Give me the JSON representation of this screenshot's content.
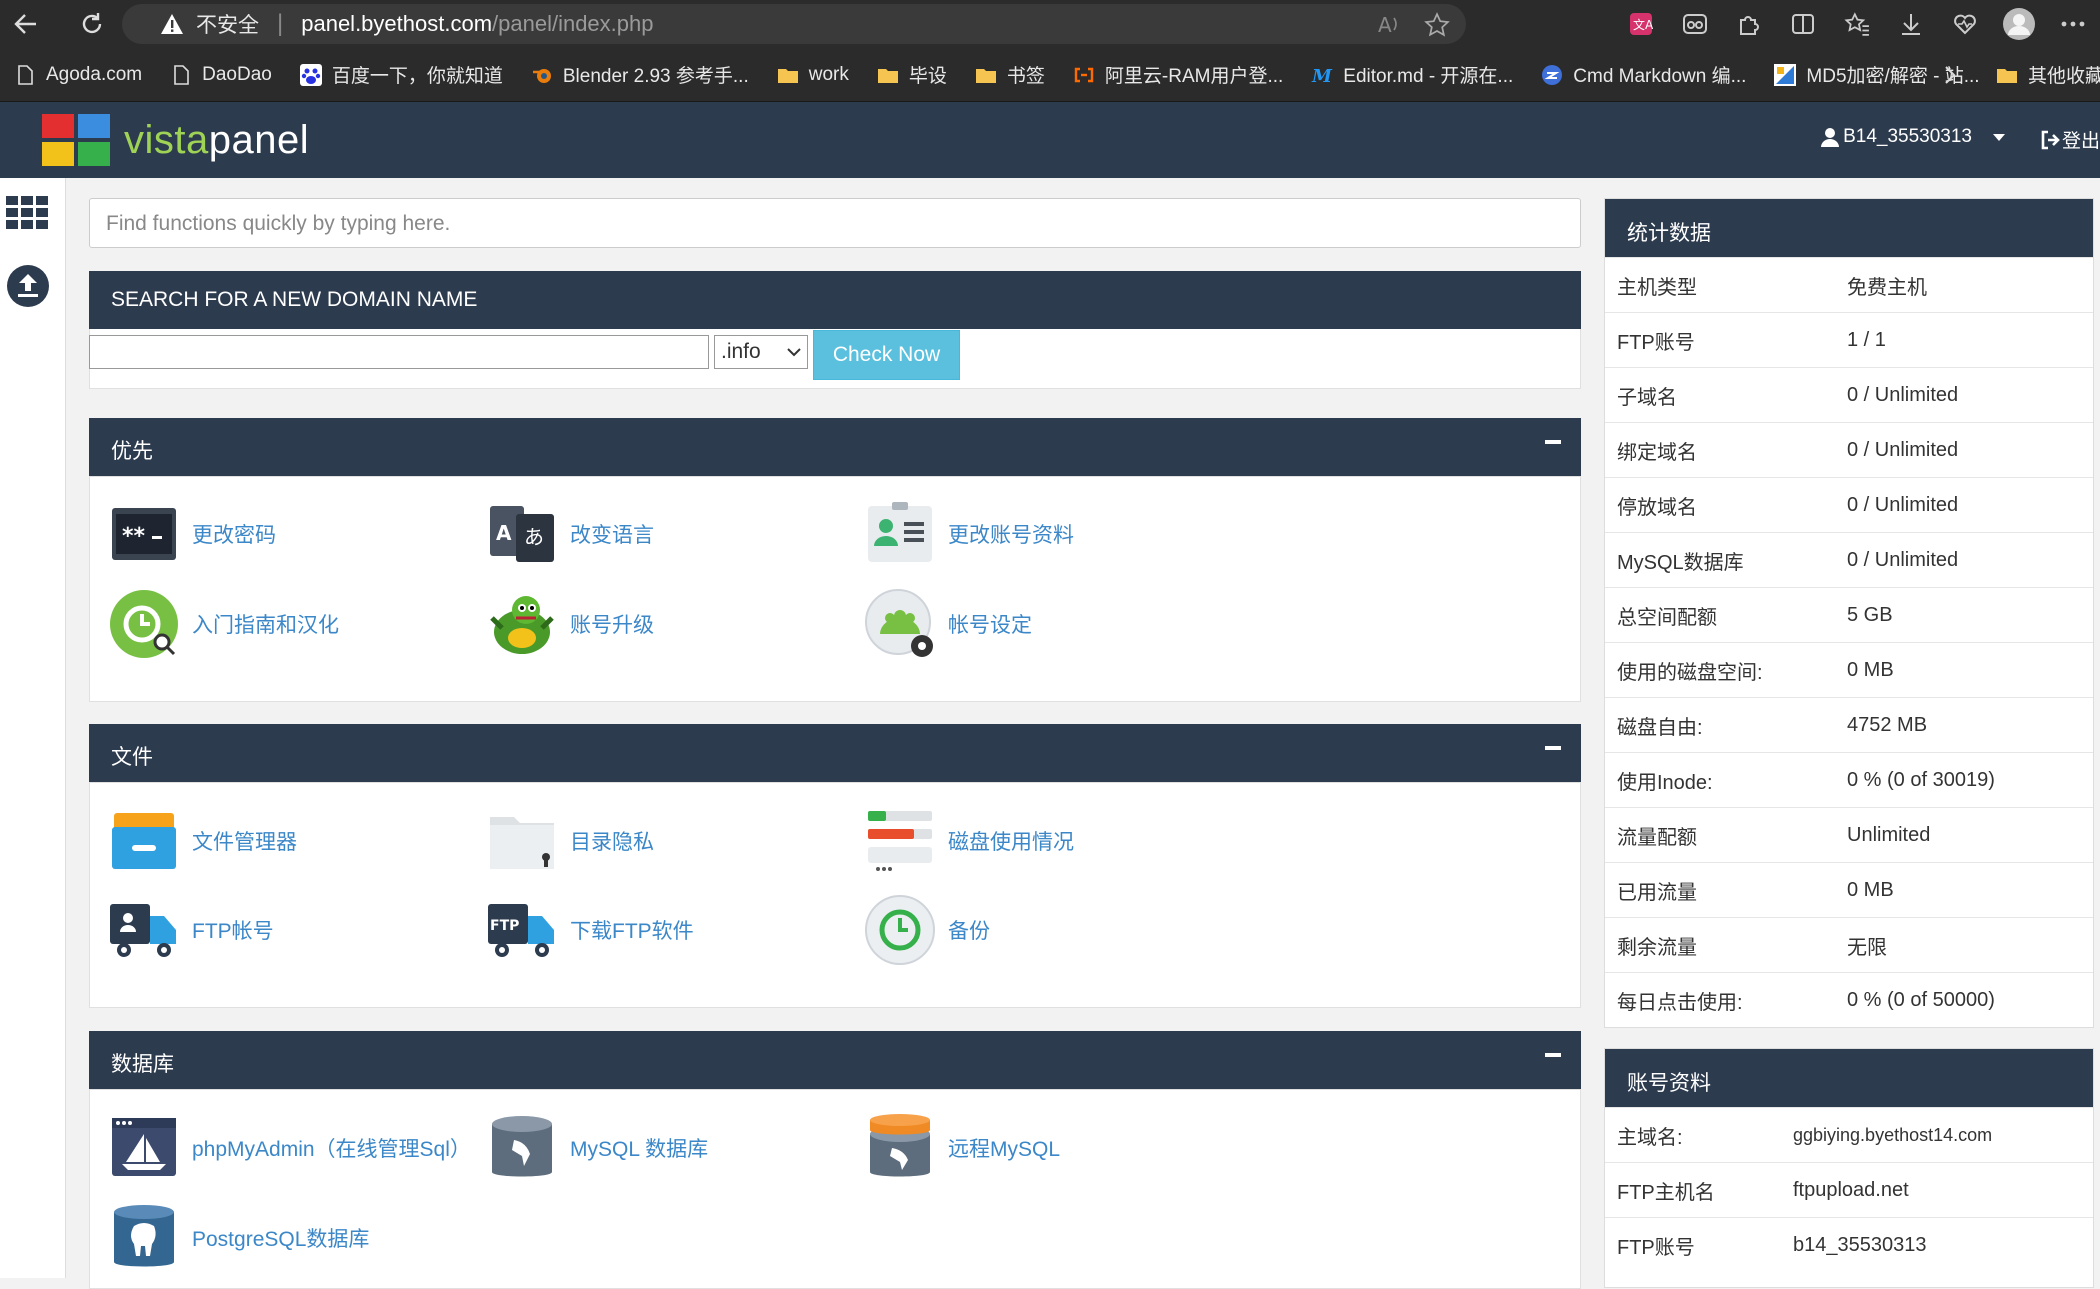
{
  "browser": {
    "insecure_label": "不安全",
    "url_host": "panel.byethost.com",
    "url_path": "/panel/index.php"
  },
  "bookmarks": [
    {
      "label": "Agoda.com",
      "icon": "page-icon"
    },
    {
      "label": "DaoDao",
      "icon": "page-icon"
    },
    {
      "label": "百度一下，你就知道",
      "icon": "baidu-icon"
    },
    {
      "label": "Blender 2.93 参考手...",
      "icon": "blender-icon"
    },
    {
      "label": "work",
      "icon": "folder-icon"
    },
    {
      "label": "毕设",
      "icon": "folder-icon"
    },
    {
      "label": "书签",
      "icon": "folder-icon"
    },
    {
      "label": "阿里云-RAM用户登...",
      "icon": "aliyun-icon"
    },
    {
      "label": "Editor.md - 开源在...",
      "icon": "editormd-icon"
    },
    {
      "label": "Cmd Markdown 编...",
      "icon": "cmd-icon"
    },
    {
      "label": "MD5加密/解密 - 站...",
      "icon": "md5-icon"
    }
  ],
  "bookmarks_other": "其他收藏",
  "app": {
    "logo_part1": "vista",
    "logo_part2": "panel",
    "username": "B14_35530313",
    "logout": "登出"
  },
  "search": {
    "placeholder": "Find functions quickly by typing here."
  },
  "domain": {
    "title": "SEARCH FOR A NEW DOMAIN NAME",
    "tld": ".info",
    "check_label": "Check Now"
  },
  "sections": [
    {
      "title": "优先",
      "items": [
        "更改密码",
        "改变语言",
        "更改账号资料",
        "入门指南和汉化",
        "账号升级",
        "帐号设定"
      ]
    },
    {
      "title": "文件",
      "items": [
        "文件管理器",
        "目录隐私",
        "磁盘使用情况",
        "FTP帐号",
        "下载FTP软件",
        "备份"
      ]
    },
    {
      "title": "数据库",
      "items": [
        "phpMyAdmin（在线管理Sql）",
        "MySQL 数据库",
        "远程MySQL",
        "PostgreSQL数据库"
      ]
    }
  ],
  "stats": {
    "title": "统计数据",
    "rows": [
      {
        "k": "主机类型",
        "v": "免费主机"
      },
      {
        "k": "FTP账号",
        "v": "1 / 1"
      },
      {
        "k": "子域名",
        "v": "0 / Unlimited"
      },
      {
        "k": "绑定域名",
        "v": "0 / Unlimited"
      },
      {
        "k": "停放域名",
        "v": "0 / Unlimited"
      },
      {
        "k": "MySQL数据库",
        "v": "0 / Unlimited"
      },
      {
        "k": "总空间配额",
        "v": "5 GB"
      },
      {
        "k": "使用的磁盘空间:",
        "v": "0 MB"
      },
      {
        "k": "磁盘自由:",
        "v": "4752 MB"
      },
      {
        "k": "使用Inode:",
        "v": "0 % (0 of 30019)"
      },
      {
        "k": "流量配额",
        "v": "Unlimited"
      },
      {
        "k": "已用流量",
        "v": "0 MB"
      },
      {
        "k": "剩余流量",
        "v": "无限"
      },
      {
        "k": "每日点击使用:",
        "v": "0 % (0 of 50000)"
      }
    ]
  },
  "account": {
    "title": "账号资料",
    "rows": [
      {
        "k": "主域名:",
        "v": "ggbiying.byethost14.com"
      },
      {
        "k": "FTP主机名",
        "v": "ftpupload.net"
      },
      {
        "k": "FTP账号",
        "v": "b14_35530313"
      }
    ]
  }
}
